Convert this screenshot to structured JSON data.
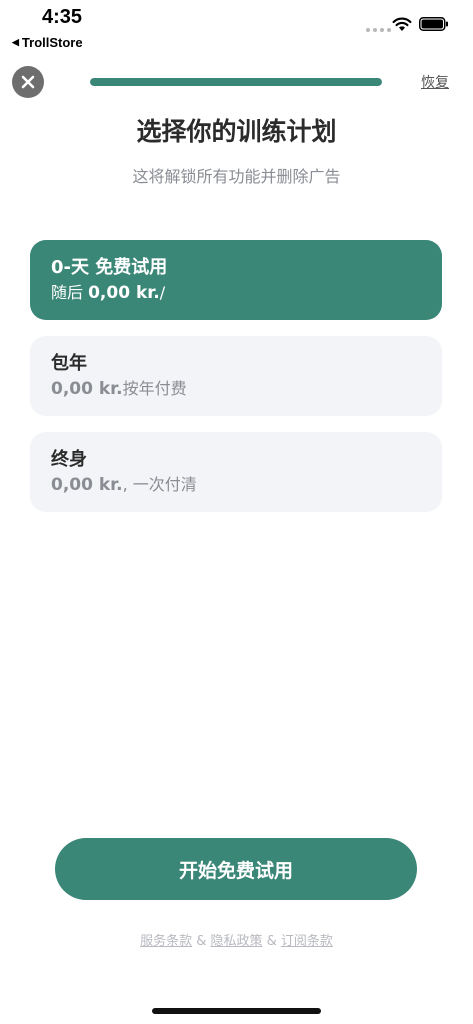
{
  "status_bar": {
    "time": "4:35",
    "back_app": "TrollStore",
    "icons": [
      "back-triangle-icon",
      "signal-icon",
      "wifi-icon",
      "battery-icon"
    ]
  },
  "header": {
    "close_icon": "close-icon",
    "progress": 1.0,
    "restore_label": "恢复"
  },
  "title": "选择你的训练计划",
  "subtitle": "这将解锁所有功能并删除广告",
  "plans": [
    {
      "name": "0-天 免费试用",
      "price_prefix": "随后 ",
      "price_value": "0,00 kr.",
      "price_suffix": "/",
      "selected": true
    },
    {
      "name": "包年",
      "price_prefix": "",
      "price_value": "0,00 kr.",
      "price_suffix": "按年付费",
      "selected": false
    },
    {
      "name": "终身",
      "price_prefix": "",
      "price_value": "0,00 kr.",
      "price_suffix": ", 一次付清",
      "selected": false
    }
  ],
  "cta_label": "开始免费试用",
  "legal": {
    "terms": "服务条款",
    "sep1": " & ",
    "privacy": "隐私政策",
    "sep2": " & ",
    "subscription": "订阅条款"
  },
  "colors": {
    "accent": "#3A8677",
    "card_bg": "#F3F4F7",
    "muted_text": "#8A8D93"
  }
}
